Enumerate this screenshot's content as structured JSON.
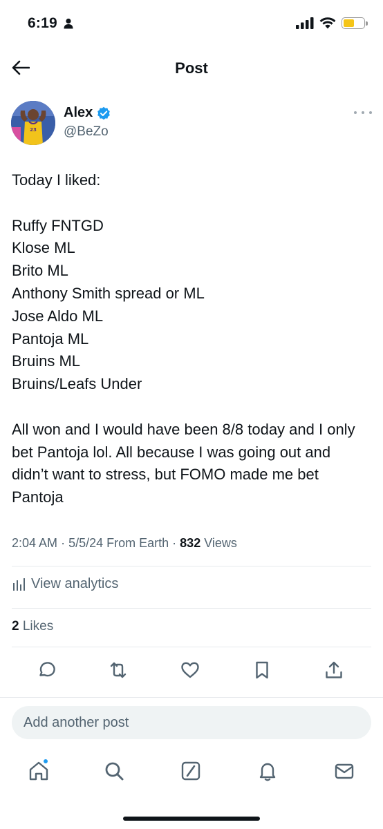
{
  "status_bar": {
    "time": "6:19",
    "battery_level": 0.55,
    "battery_color": "#f5c518"
  },
  "header": {
    "back_icon": "arrow-left-icon",
    "title": "Post"
  },
  "author": {
    "name": "Alex",
    "handle": "@BeZo",
    "verified": true,
    "verified_color": "#1d9bf0",
    "more_icon": "more-horizontal-icon"
  },
  "post": {
    "text": "Today I liked:\n\nRuffy FNTGD\nKlose ML\nBrito ML\nAnthony Smith spread or ML\nJose Aldo ML\nPantoja ML\nBruins ML\nBruins/Leafs Under\n\nAll won and I would have been 8/8 today and I only bet Pantoja lol. All because I was going out and didn’t want to stress, but FOMO made me bet Pantoja"
  },
  "meta": {
    "time": "2:04 AM",
    "date": "5/5/24",
    "source": "From Earth",
    "views_count": "832",
    "views_label": "Views"
  },
  "analytics": {
    "label": "View analytics",
    "icon": "analytics-icon"
  },
  "likes": {
    "count": "2",
    "label": "Likes"
  },
  "actions": [
    {
      "name": "reply",
      "icon": "reply-icon"
    },
    {
      "name": "repost",
      "icon": "repost-icon"
    },
    {
      "name": "like",
      "icon": "heart-icon"
    },
    {
      "name": "bookmark",
      "icon": "bookmark-icon"
    },
    {
      "name": "share",
      "icon": "share-icon"
    }
  ],
  "composer": {
    "placeholder": "Add another post"
  },
  "tabbar": [
    {
      "name": "home",
      "icon": "home-icon",
      "has_notification_dot": true
    },
    {
      "name": "search",
      "icon": "search-icon"
    },
    {
      "name": "grok",
      "icon": "grok-icon"
    },
    {
      "name": "notifications",
      "icon": "bell-icon"
    },
    {
      "name": "messages",
      "icon": "mail-icon"
    }
  ],
  "colors": {
    "text_primary": "#0f1419",
    "text_secondary": "#536471",
    "accent": "#1d9bf0",
    "divider": "#e6e9ec"
  }
}
